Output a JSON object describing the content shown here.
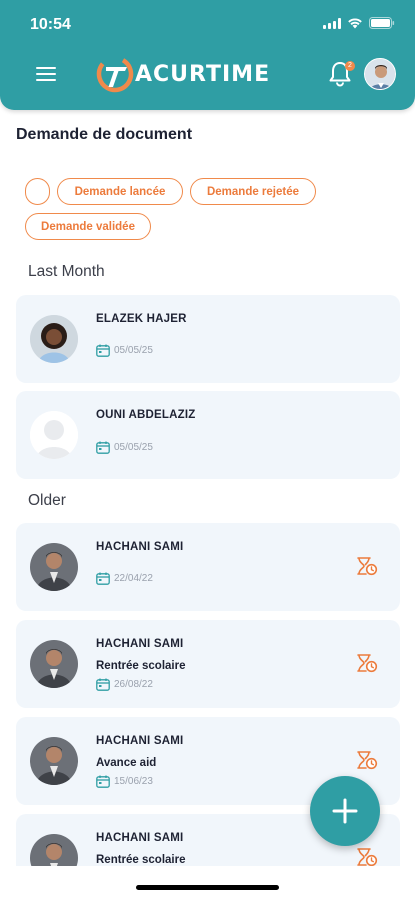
{
  "status_bar": {
    "time": "10:54"
  },
  "header": {
    "logo_text": "ACURTIME",
    "notification_count": "2"
  },
  "page": {
    "title": "Demande de document"
  },
  "filters": {
    "chips": [
      "Demande lancée",
      "Demande rejetée",
      "Demande validée"
    ]
  },
  "sections": {
    "last_month": "Last Month",
    "older": "Older"
  },
  "cards": [
    {
      "name": "ELAZEK  HAJER",
      "subject": "",
      "date": "05/05/25"
    },
    {
      "name": "OUNI ABDELAZIZ",
      "subject": "",
      "date": "05/05/25"
    },
    {
      "name": "HACHANI SAMI",
      "subject": "",
      "date": "22/04/22"
    },
    {
      "name": "HACHANI SAMI",
      "subject": "Rentrée scolaire",
      "date": "26/08/22"
    },
    {
      "name": "HACHANI SAMI",
      "subject": "Avance aid",
      "date": "15/06/23"
    },
    {
      "name": "HACHANI SAMI",
      "subject": "Rentrée scolaire",
      "date": ""
    }
  ],
  "colors": {
    "primary": "#2f9ea4",
    "accent": "#f08a4b",
    "card_bg": "#f1f6fb"
  },
  "icons": {
    "menu": "menu-icon",
    "bell": "bell-icon",
    "calendar": "calendar-icon",
    "pending": "hourglass-clock-icon",
    "add": "plus-icon"
  }
}
